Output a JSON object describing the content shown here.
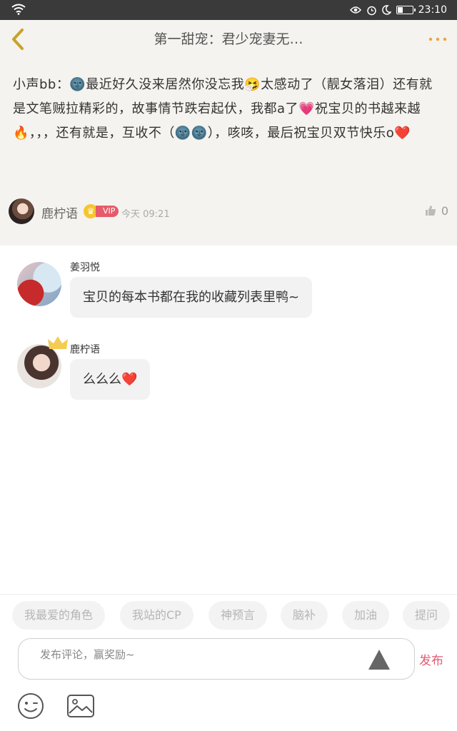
{
  "status_bar": {
    "time": "23:10"
  },
  "header": {
    "title": "第一甜宠：君少宠妻无…"
  },
  "main_comment": {
    "text": "小声bb：🌚最近好久没来居然你没忘我🤧太感动了（靓女落泪）还有就是文笔贼拉精彩的，故事情节跌宕起伏，我都a了💗祝宝贝的书越来越🔥，，，还有就是，互收不（🌚🌚），咳咳，最后祝宝贝双节快乐o❤️",
    "author": "鹿柠语",
    "badge": "VIP",
    "timestamp": "今天 09:21",
    "likes": "0"
  },
  "replies": [
    {
      "name": "姜羽悦",
      "text": "宝贝的每本书都在我的收藏列表里鸭~"
    },
    {
      "name": "鹿柠语",
      "text": "么么么❤️"
    }
  ],
  "tags": [
    "我最爱的角色",
    "我站的CP",
    "神预言",
    "脑补",
    "加油",
    "提问"
  ],
  "input": {
    "placeholder": "发布评论，赢奖励~",
    "publish_label": "发布"
  },
  "colors": {
    "accent": "#e25b74",
    "header_bg": "#f4f3ef",
    "back_arrow": "#c9a227",
    "more_dots": "#f0a040"
  }
}
